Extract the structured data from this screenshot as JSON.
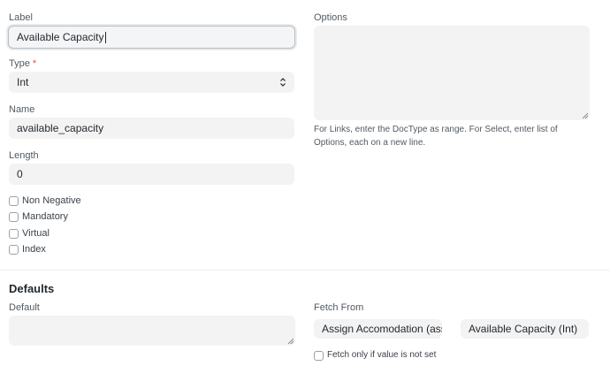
{
  "label": {
    "label": "Label",
    "value": "Available Capacity"
  },
  "type": {
    "label": "Type",
    "required_mark": "*",
    "value": "Int"
  },
  "name": {
    "label": "Name",
    "value": "available_capacity"
  },
  "length": {
    "label": "Length",
    "value": "0"
  },
  "checkboxes": [
    {
      "label": "Non Negative",
      "checked": false
    },
    {
      "label": "Mandatory",
      "checked": false
    },
    {
      "label": "Virtual",
      "checked": false
    },
    {
      "label": "Index",
      "checked": false
    }
  ],
  "options": {
    "label": "Options",
    "value": "",
    "help": "For Links, enter the DocType as range. For Select, enter list of Options, each on a new line."
  },
  "defaults": {
    "title": "Defaults",
    "default_label": "Default",
    "default_value": "",
    "fetch_from_label": "Fetch From",
    "fetch_from_doctype": "Assign Accomodation (assign",
    "fetch_from_field": "Available Capacity (Int)",
    "fetch_if_empty_label": "Fetch only if value is not set",
    "fetch_if_empty_checked": false
  },
  "icons": {
    "select": "chevron-up-down-icon",
    "resize": "resize-handle-icon"
  }
}
